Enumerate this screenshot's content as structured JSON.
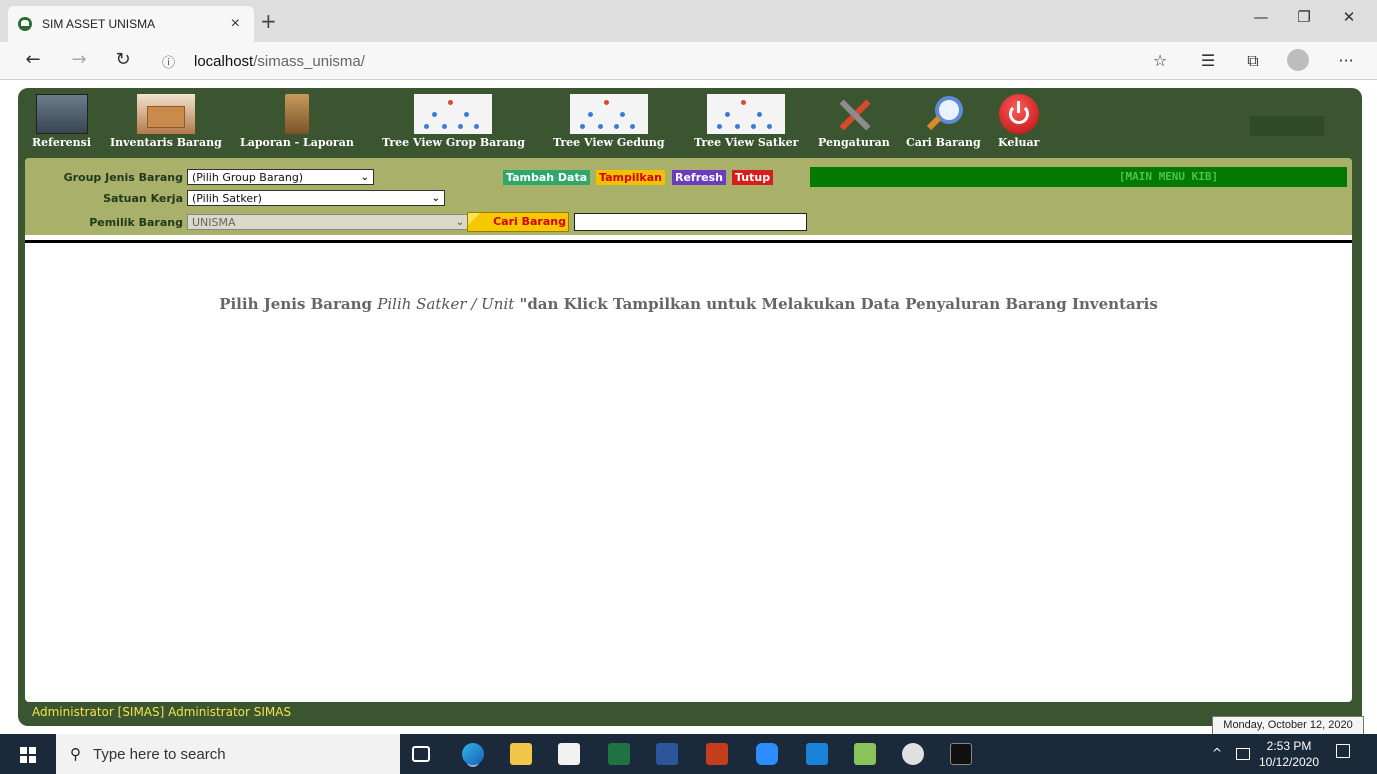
{
  "browser": {
    "tab_title": "SIM ASSET UNISMA",
    "tab_close": "×",
    "new_tab": "+",
    "url_host": "localhost",
    "url_path": "/simass_unisma/",
    "window_controls": [
      "—",
      "❐",
      "✕"
    ],
    "nav": {
      "back": "←",
      "forward": "→",
      "refresh": "↻"
    },
    "toolbar_icons": [
      "star-icon",
      "favorites-icon",
      "collections-icon",
      "profile-icon",
      "more-icon"
    ]
  },
  "menu": {
    "items": [
      {
        "label": "Referensi",
        "icon": "reference-image"
      },
      {
        "label": "Inventaris Barang",
        "icon": "inventory-image"
      },
      {
        "label": "Laporan - Laporan",
        "icon": "report-cabinet-image"
      },
      {
        "label": "Tree View Grop Barang",
        "icon": "tree-diagram-image"
      },
      {
        "label": "Tree View Gedung",
        "icon": "tree-diagram-image"
      },
      {
        "label": "Tree View Satker",
        "icon": "tree-diagram-image"
      },
      {
        "label": "Pengaturan",
        "icon": "tools-image"
      },
      {
        "label": "Cari Barang",
        "icon": "search-image"
      },
      {
        "label": "Keluar",
        "icon": "power-image"
      }
    ]
  },
  "filters": {
    "group_label": "Group Jenis Barang",
    "group_value": "(Pilih Group Barang)",
    "satker_label": "Satuan Kerja",
    "satker_value": "(Pilih Satker)",
    "pemilik_label": "Pemilik Barang",
    "pemilik_value": "UNISMA",
    "cari_button": "Cari Barang",
    "cari_input_value": ""
  },
  "actions": {
    "tambah": "Tambah Data",
    "tampilkan": "Tampilkan",
    "refresh": "Refresh",
    "tutup": "Tutup",
    "main_menu_label": "[MAIN MENU KIB]"
  },
  "colors": {
    "app_bg": "#3b5531",
    "filter_bg": "#a8b06a",
    "tambah_bg": "#2ea86a",
    "tampilkan_bg": "#f2c200",
    "refresh_bg": "#6a3cc0",
    "tutup_bg": "#d81d1d",
    "main_menu_bg": "#037803"
  },
  "message": {
    "part1": "Pilih Jenis Barang ",
    "part2": "Pilih Satker / Unit",
    "part3": " \"dan Klick Tampilkan untuk Melakukan Data Penyaluran Barang Inventaris"
  },
  "footer": {
    "user": "Administrator [SIMAS] Administrator SIMAS"
  },
  "tooltip": "Monday, October 12, 2020",
  "taskbar": {
    "search_placeholder": "Type here to search",
    "time": "2:53 PM",
    "date": "10/12/2020",
    "tray_up": "^",
    "apps": [
      "task-view",
      "edge",
      "file-explorer",
      "store",
      "excel",
      "word",
      "powerpoint",
      "zoom",
      "mail",
      "project",
      "paint",
      "terminal"
    ]
  }
}
